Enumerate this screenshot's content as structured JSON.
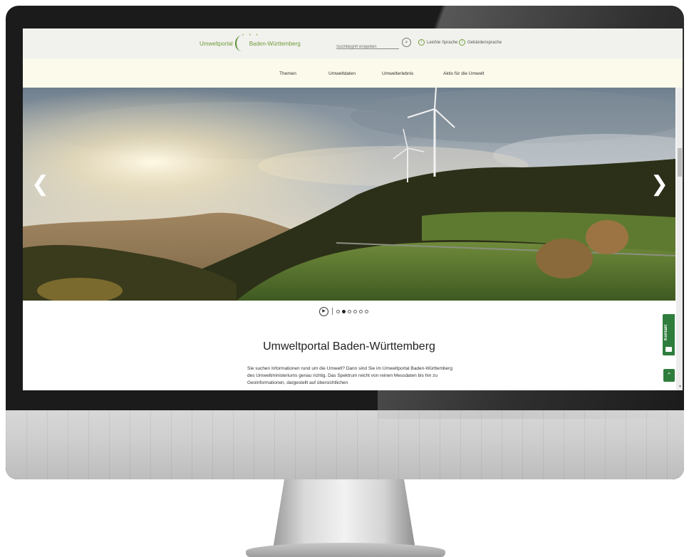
{
  "header": {
    "logo": {
      "left": "Umweltportal",
      "right": "Baden-Württemberg"
    },
    "search": {
      "placeholder": "Suchbegriff eingeben"
    },
    "links": [
      {
        "label": "Leichte Sprache"
      },
      {
        "label": "Gebärdensprache"
      }
    ]
  },
  "nav": {
    "items": [
      {
        "label": "Themen"
      },
      {
        "label": "Umweltdaten"
      },
      {
        "label": "Umwelterlebnis"
      },
      {
        "label": "Aktiv für die Umwelt"
      }
    ]
  },
  "carousel": {
    "prev": "❮",
    "next": "❯",
    "slide_count": 6,
    "active_index": 1
  },
  "content": {
    "title": "Umweltportal Baden-Württemberg",
    "intro": "Sie suchen Informationen rund um die Umwelt? Dann sind Sie im Umweltportal Baden-Württemberg des Umweltministeriums genau richtig. Das Spektrum reicht von reinen Messdaten bis hin zu Geoinformationen, dargestellt auf übersichtlichen"
  },
  "side_widget": {
    "label": "Kontakt"
  },
  "colors": {
    "brand_green": "#2f7d3d",
    "logo_green": "#6f9d3a",
    "nav_bg": "#fbfaeb"
  }
}
